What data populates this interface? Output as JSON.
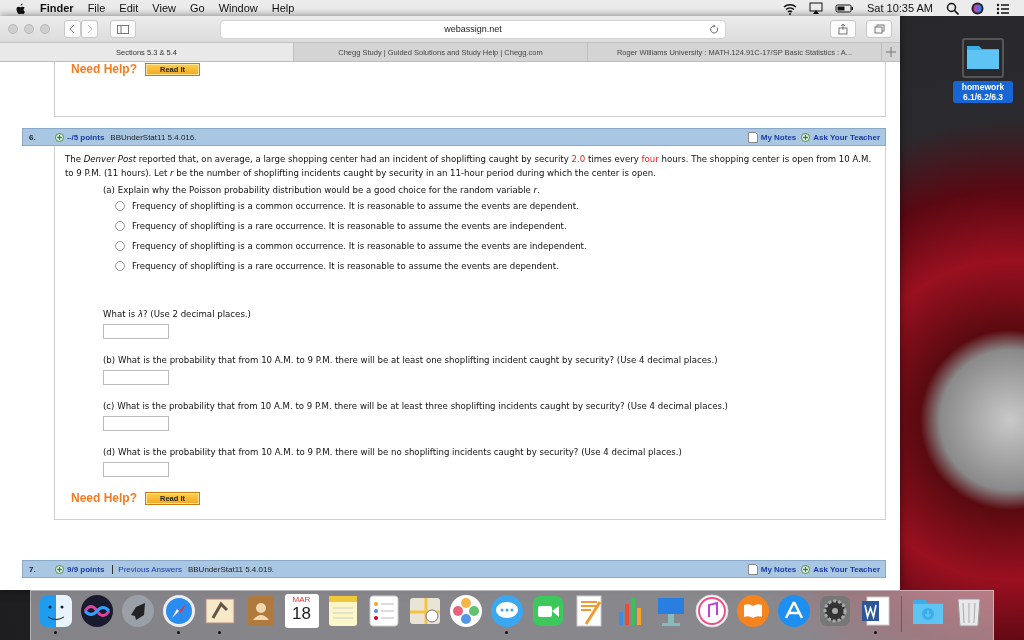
{
  "menu_bar": {
    "app": "Finder",
    "menus": [
      "File",
      "Edit",
      "View",
      "Go",
      "Window",
      "Help"
    ],
    "clock": "Sat 10:35 AM"
  },
  "browser": {
    "address": "webassign.net",
    "tabs": [
      {
        "title": "Sections 5.3 & 5.4",
        "selected": true
      },
      {
        "title": "Chegg Study | Guided Solutions and Study Help | Chegg.com",
        "selected": false
      },
      {
        "title": "Roger Williams University : MATH.124.91C-17/SP Basic Statistics : A...",
        "selected": false
      }
    ]
  },
  "previous_question": {
    "help_label": "Need Help?",
    "read_button": "Read It"
  },
  "question": {
    "number": "6.",
    "points": "–/5 points",
    "code": "BBUnderStat11 5.4.016.",
    "notes": "My Notes",
    "ask": "Ask Your Teacher",
    "intro": [
      {
        "kind": "plain",
        "text": "The *Denver Post* reported that, on average, a large shopping center had an incident of shoplifting caught by security"
      },
      {
        "kind": "value",
        "text": "2.0"
      },
      {
        "kind": "plain",
        "text": "times every"
      },
      {
        "kind": "value",
        "text": "four"
      },
      {
        "kind": "plain",
        "text": "hours. The shopping center is open from 10 A.M. to 9 P.M. (11 hours). Let *r* be the number of shoplifting incidents caught by security in an 11-hour period during which the center is open."
      }
    ],
    "part_a": "(a) Explain why the Poisson probability distribution would be a good choice for the random variable *r*.",
    "options": [
      {
        "text": "Frequency of shoplifting is a common occurrence. It is reasonable to assume the events are dependent.",
        "selected": false
      },
      {
        "text": "Frequency of shoplifting is a rare occurrence. It is reasonable to assume the events are independent.",
        "selected": false
      },
      {
        "text": "Frequency of shoplifting is a common occurrence. It is reasonable to assume the events are independent.",
        "selected": false
      },
      {
        "text": "Frequency of shoplifting is a rare occurrence. It is reasonable to assume the events are dependent.",
        "selected": false
      }
    ],
    "answers": [
      {
        "prompt": "What is *λ*? (Use 2 decimal places.)"
      },
      {
        "prompt": "(b) What is the probability that from 10 A.M. to 9 P.M. there will be at least one shoplifting incident caught by security? (Use 4 decimal places.)"
      },
      {
        "prompt": "(c) What is the probability that from 10 A.M. to 9 P.M. there will be at least three shoplifting incidents caught by security? (Use 4 decimal places.)"
      },
      {
        "prompt": "(d) What is the probability that from 10 A.M. to 9 P.M. there will be no shoplifting incidents caught by security? (Use 4 decimal places.)"
      }
    ],
    "help_label": "Need Help?",
    "read_button": "Read It"
  },
  "next_question": {
    "number": "7.",
    "points": "9/9 points",
    "previous_answers": "Previous Answers",
    "code": "BBUnderStat11 5.4.019.",
    "notes": "My Notes",
    "ask": "Ask Your Teacher"
  },
  "desktop_icon": {
    "label": "homework 6.1/6.2/6.3",
    "selected": true
  },
  "dock": {
    "items": [
      {
        "kind": "finder",
        "running": true
      },
      {
        "kind": "siri",
        "running": false
      },
      {
        "kind": "launchpad",
        "running": false
      },
      {
        "kind": "safari",
        "running": true
      },
      {
        "kind": "mail",
        "running": true
      },
      {
        "kind": "contacts",
        "running": false
      },
      {
        "kind": "calendar",
        "running": false,
        "month": "MAR",
        "day": "18"
      },
      {
        "kind": "notes",
        "running": false
      },
      {
        "kind": "reminders",
        "running": false
      },
      {
        "kind": "maps",
        "running": false
      },
      {
        "kind": "photos",
        "running": false
      },
      {
        "kind": "messages",
        "running": true
      },
      {
        "kind": "facetime",
        "running": false
      },
      {
        "kind": "pages",
        "running": false
      },
      {
        "kind": "numbers",
        "running": false
      },
      {
        "kind": "keynote",
        "running": false
      },
      {
        "kind": "itunes",
        "running": false
      },
      {
        "kind": "ibooks",
        "running": false
      },
      {
        "kind": "appstore",
        "running": false
      },
      {
        "kind": "preferences",
        "running": false
      },
      {
        "kind": "word",
        "running": true
      },
      {
        "kind": "downloads",
        "running": false
      },
      {
        "kind": "trash",
        "running": false
      }
    ]
  }
}
